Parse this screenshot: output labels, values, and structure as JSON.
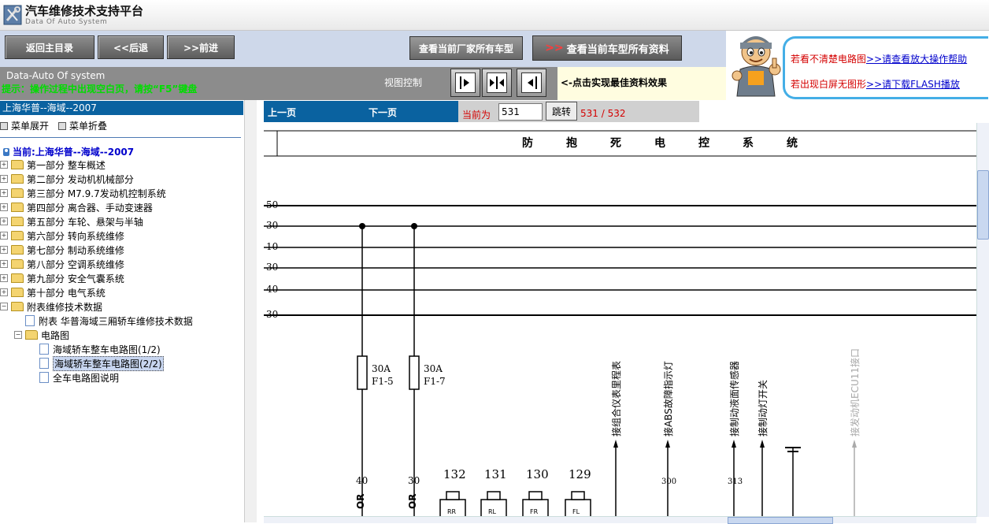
{
  "app": {
    "title": "汽车维修技术支持平台",
    "subtitle": "Data Of Auto System"
  },
  "toolbar": {
    "back_main": "返回主目录",
    "back": "<<后退",
    "forward": ">>前进",
    "view_models": "查看当前厂家所有车型",
    "view_data": "查看当前车型所有资料",
    "view_data_prefix": ">>"
  },
  "help": {
    "line1_text": "若看不清楚电路图",
    "line1_link": ">>请查看放大操作帮助",
    "line2_text": "若出现白屏无图形",
    "line2_link": ">>请下载FLASH播放"
  },
  "status": {
    "title": "Data-Auto Of system",
    "tip": "提示：操作过程中出现空白页，请按“F5”键盘",
    "view_label": "视图控制",
    "view_hint": "<-点击实现最佳资料效果"
  },
  "tree": {
    "header": "上海华普--海域--2007",
    "expand": "菜单展开",
    "collapse": "菜单折叠",
    "current": "当前:上海华普--海域--2007",
    "items": [
      {
        "label": "第一部分 整车概述"
      },
      {
        "label": "第二部分 发动机机械部分"
      },
      {
        "label": "第三部分 M7.9.7发动机控制系统"
      },
      {
        "label": "第四部分 离合器、手动变速器"
      },
      {
        "label": "第五部分 车轮、悬架与半轴"
      },
      {
        "label": "第六部分 转向系统维修"
      },
      {
        "label": "第七部分 制动系统维修"
      },
      {
        "label": "第八部分 空调系统维修"
      },
      {
        "label": "第九部分 安全气囊系统"
      },
      {
        "label": "第十部分 电气系统"
      },
      {
        "label": "附表维修技术数据"
      }
    ],
    "sub_appendix": "附表 华普海域三厢轿车维修技术数据",
    "sub_circuit": "电路图",
    "circuit_items": [
      {
        "label": "海域轿车整车电路图(1/2)"
      },
      {
        "label": "海域轿车整车电路图(2/2)"
      },
      {
        "label": "全车电路图说明"
      }
    ]
  },
  "pager": {
    "prev": "上一页",
    "next": "下一页",
    "current_label": "当前为",
    "current_value": "531",
    "jump": "跳转",
    "count": "531 / 532"
  },
  "diagram": {
    "title_chars": [
      "防",
      "抱",
      "死",
      "电",
      "控",
      "系",
      "统"
    ],
    "bus_labels": [
      "50",
      "30",
      "10",
      "30",
      "40",
      "30"
    ],
    "fuses": [
      {
        "rating": "30A",
        "code": "F1-5",
        "wire": "40",
        "color": "OR"
      },
      {
        "rating": "30A",
        "code": "F1-7",
        "wire": "30",
        "color": "OR"
      }
    ],
    "connector_numbers": [
      "132",
      "131",
      "130",
      "129"
    ],
    "connector_pins": [
      "RR",
      "RL",
      "FR",
      "FL"
    ],
    "vertical_labels": [
      "接组合仪表里程表",
      "接ABS故障指示灯",
      "接制动液面传感器",
      "接制动灯开关",
      "接发动机ECU11接口"
    ],
    "wire_numbers": [
      "300",
      "313"
    ]
  }
}
